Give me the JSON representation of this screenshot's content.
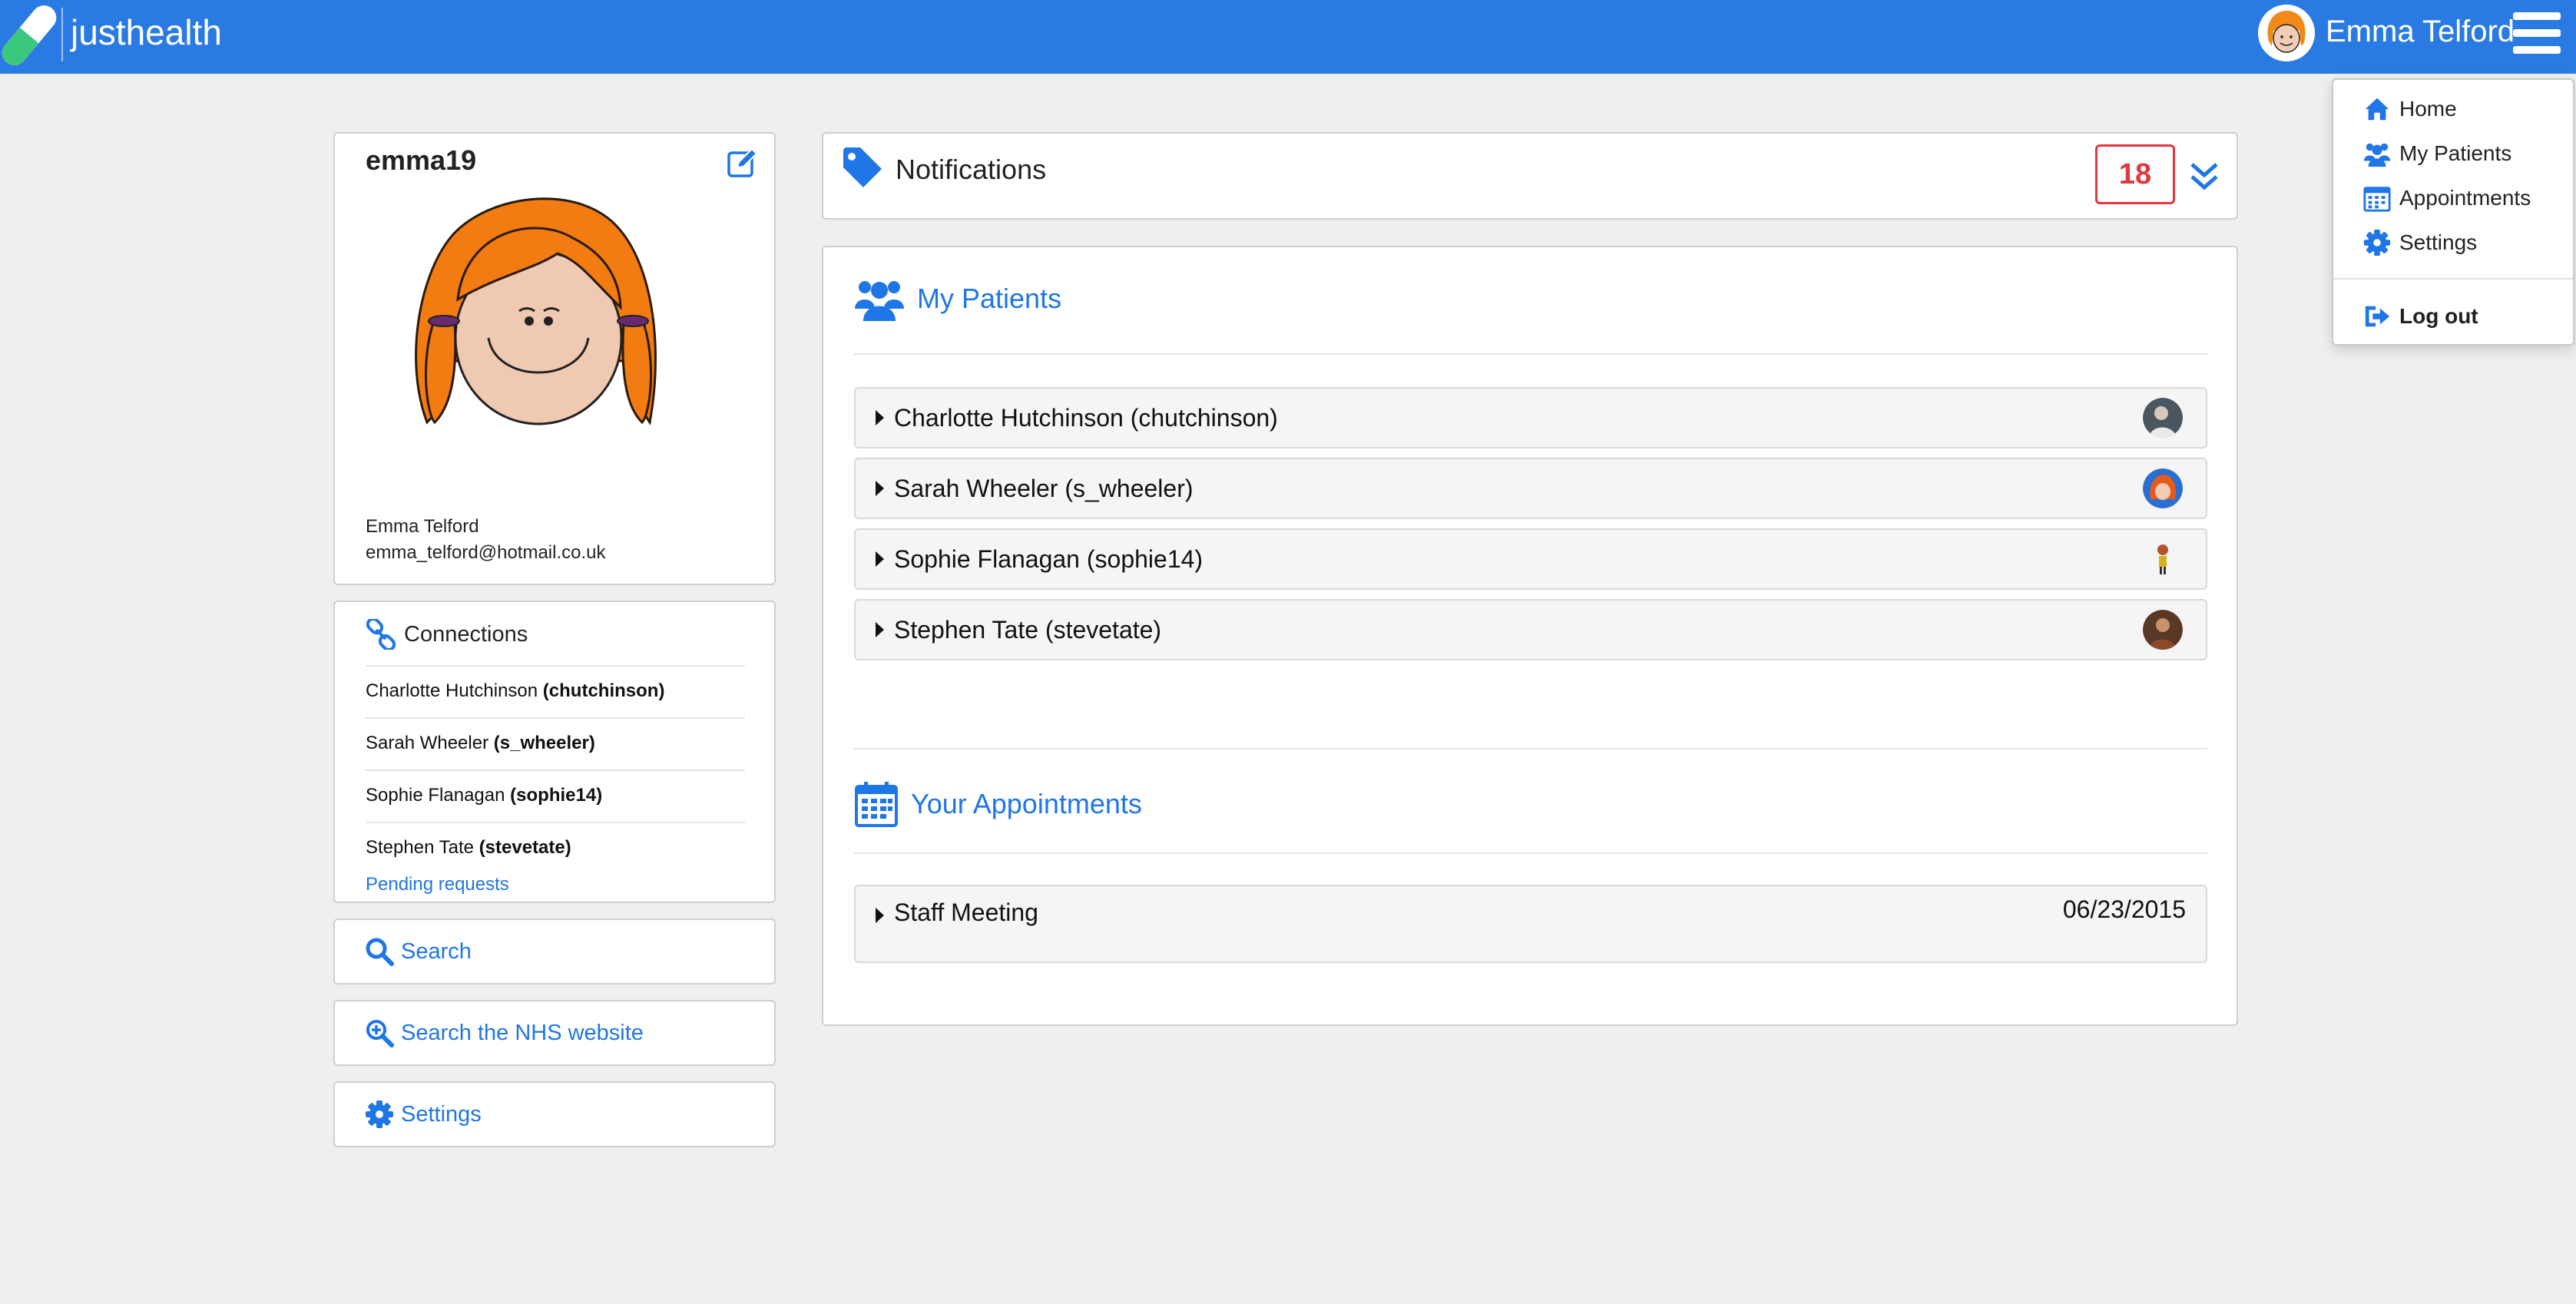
{
  "app": {
    "brand": "justhealth"
  },
  "header": {
    "user_name": "Emma Telford"
  },
  "menu": {
    "items": [
      {
        "label": "Home",
        "icon": "home-icon"
      },
      {
        "label": "My Patients",
        "icon": "users-icon"
      },
      {
        "label": "Appointments",
        "icon": "calendar-icon"
      },
      {
        "label": "Settings",
        "icon": "gear-icon"
      }
    ],
    "logout": "Log out"
  },
  "profile": {
    "username": "emma19",
    "name": "Emma Telford",
    "email": "emma_telford@hotmail.co.uk"
  },
  "connections": {
    "title": "Connections",
    "items": [
      {
        "name": "Charlotte Hutchinson",
        "username": "(chutchinson)"
      },
      {
        "name": "Sarah Wheeler",
        "username": "(s_wheeler)"
      },
      {
        "name": "Sophie Flanagan",
        "username": "(sophie14)"
      },
      {
        "name": "Stephen Tate",
        "username": "(stevetate)"
      }
    ],
    "pending": "Pending requests"
  },
  "sidebar_buttons": {
    "search": "Search",
    "search_nhs": "Search the NHS website",
    "settings": "Settings"
  },
  "notifications": {
    "title": "Notifications",
    "count": "18"
  },
  "patients": {
    "title": "My Patients",
    "items": [
      {
        "label": "Charlotte Hutchinson (chutchinson)"
      },
      {
        "label": "Sarah Wheeler (s_wheeler)"
      },
      {
        "label": "Sophie Flanagan (sophie14)"
      },
      {
        "label": "Stephen Tate (stevetate)"
      }
    ]
  },
  "appointments": {
    "title": "Your Appointments",
    "items": [
      {
        "title": "Staff Meeting",
        "date": "06/23/2015"
      }
    ]
  },
  "colors": {
    "topbar": "#2a7ae4",
    "accent": "#1f76e6",
    "badge": "#e0383f",
    "background": "#efefef"
  }
}
